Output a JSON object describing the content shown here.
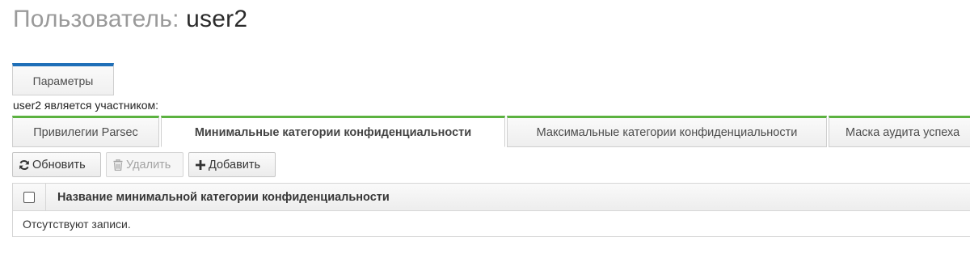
{
  "header": {
    "title_prefix": "Пользователь: ",
    "user_name": "user2"
  },
  "top_tabs": [
    {
      "label": "Параметры",
      "active": true
    }
  ],
  "membership_label": "user2 является участником:",
  "sub_tabs": [
    {
      "label": "Привилегии Parsec",
      "active": false
    },
    {
      "label": "Минимальные категории конфиденциальности",
      "active": true
    },
    {
      "label": "Максимальные категории конфиденциальности",
      "active": false
    },
    {
      "label": "Маска аудита успеха",
      "active": false
    }
  ],
  "toolbar": {
    "refresh_label": "Обновить",
    "delete_label": "Удалить",
    "add_label": "Добавить",
    "refresh_icon": "refresh-icon",
    "delete_icon": "trash-icon",
    "add_icon": "plus-icon"
  },
  "table": {
    "column_header": "Название минимальной категории конфиденциальности",
    "empty_text": "Отсутствуют записи."
  },
  "colors": {
    "primary_tab_accent": "#1f6fb8",
    "sub_tab_accent": "#5bb240"
  }
}
